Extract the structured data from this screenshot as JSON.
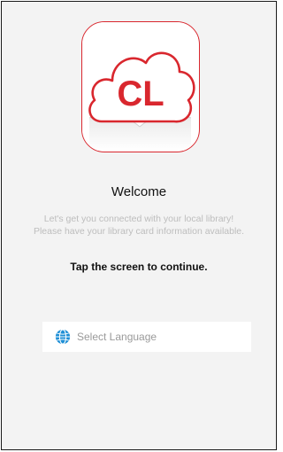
{
  "logo": {
    "text": "CL",
    "brand_color": "#d9272e"
  },
  "welcome": {
    "title": "Welcome",
    "subtitle_line1": "Let's get you connected with your local library!",
    "subtitle_line2": "Please have your library card information available.",
    "tap_prompt": "Tap the screen to continue."
  },
  "language_select": {
    "icon": "globe-icon",
    "icon_color": "#1e8fd6",
    "placeholder": "Select Language"
  }
}
